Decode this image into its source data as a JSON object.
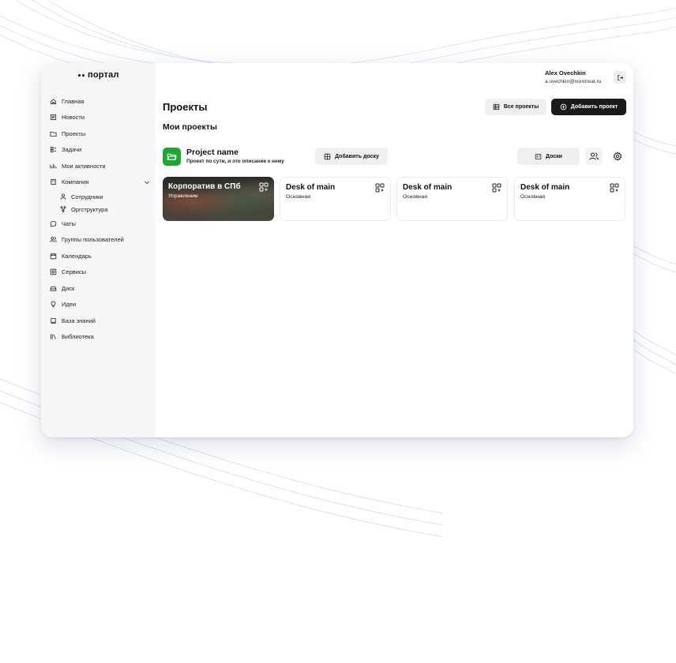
{
  "app": {
    "logo_text": "портал"
  },
  "sidebar": {
    "items": [
      {
        "label": "Главная",
        "icon": "home-icon"
      },
      {
        "label": "Новости",
        "icon": "news-icon"
      },
      {
        "label": "Проекты",
        "icon": "folder-icon"
      },
      {
        "label": "Задачи",
        "icon": "tasks-icon"
      },
      {
        "label": "Мои активности",
        "icon": "activity-icon"
      },
      {
        "label": "Компания",
        "icon": "building-icon",
        "expanded": true,
        "children": [
          {
            "label": "Сотрудники",
            "icon": "person-icon"
          },
          {
            "label": "Оргструктура",
            "icon": "org-structure-icon"
          }
        ]
      },
      {
        "label": "Чаты",
        "icon": "chat-icon"
      },
      {
        "label": "Группы пользователей",
        "icon": "users-icon"
      },
      {
        "label": "Календарь",
        "icon": "calendar-icon"
      },
      {
        "label": "Сервисы",
        "icon": "services-icon"
      },
      {
        "label": "Диск",
        "icon": "disk-icon"
      },
      {
        "label": "Идеи",
        "icon": "lightbulb-icon"
      },
      {
        "label": "База знаний",
        "icon": "book-icon"
      },
      {
        "label": "Библиотека",
        "icon": "library-icon"
      }
    ]
  },
  "user": {
    "name": "Alex Ovechkin",
    "email": "a.ovechkin@noretreat.ru"
  },
  "page": {
    "title": "Проекты",
    "all_projects_label": "Все проекты",
    "add_project_label": "Добавить проект",
    "section_title": "Мои проекты"
  },
  "project": {
    "name": "Project name",
    "description": "Проект по сути, и это описание к нему",
    "add_board_label": "Добавить доску",
    "boards_label": "Доски",
    "color": "#1ea832"
  },
  "boards": [
    {
      "title": "Корпоратив в СПб",
      "subtitle": "Управление",
      "has_cover": true
    },
    {
      "title": "Desk of main",
      "subtitle": "Основная",
      "has_cover": false
    },
    {
      "title": "Desk of main",
      "subtitle": "Основная",
      "has_cover": false
    },
    {
      "title": "Desk of main",
      "subtitle": "Основная",
      "has_cover": false
    }
  ],
  "colors": {
    "accent_dark": "#1a1a1a",
    "project_green": "#1ea832",
    "sidebar_bg": "#f6f6f7"
  }
}
